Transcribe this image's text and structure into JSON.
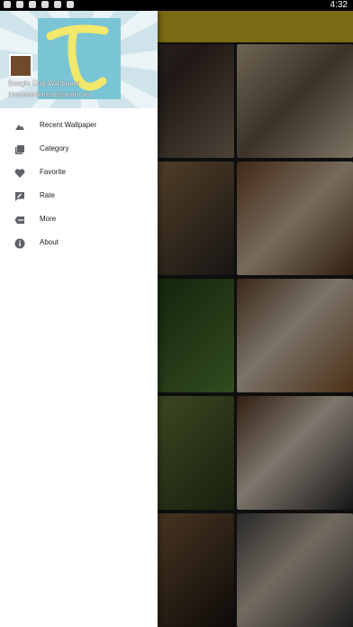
{
  "status_bar": {
    "time": "4:32"
  },
  "drawer": {
    "header": {
      "app_name": "Beagle Dog Wallpaper",
      "email": "bitayasandonesa@gmail.com"
    },
    "menu": [
      {
        "label": "Recent Wallpaper",
        "icon": "landscape-icon"
      },
      {
        "label": "Category",
        "icon": "collections-icon"
      },
      {
        "label": "Favorite",
        "icon": "heart-icon"
      },
      {
        "label": "Rate",
        "icon": "rate-review-icon"
      },
      {
        "label": "More",
        "icon": "more-dots-icon"
      },
      {
        "label": "About",
        "icon": "info-icon"
      }
    ]
  },
  "colors": {
    "appbar": "#7a6a13",
    "drawer_bg": "#ffffff",
    "icon": "#5f6368"
  }
}
